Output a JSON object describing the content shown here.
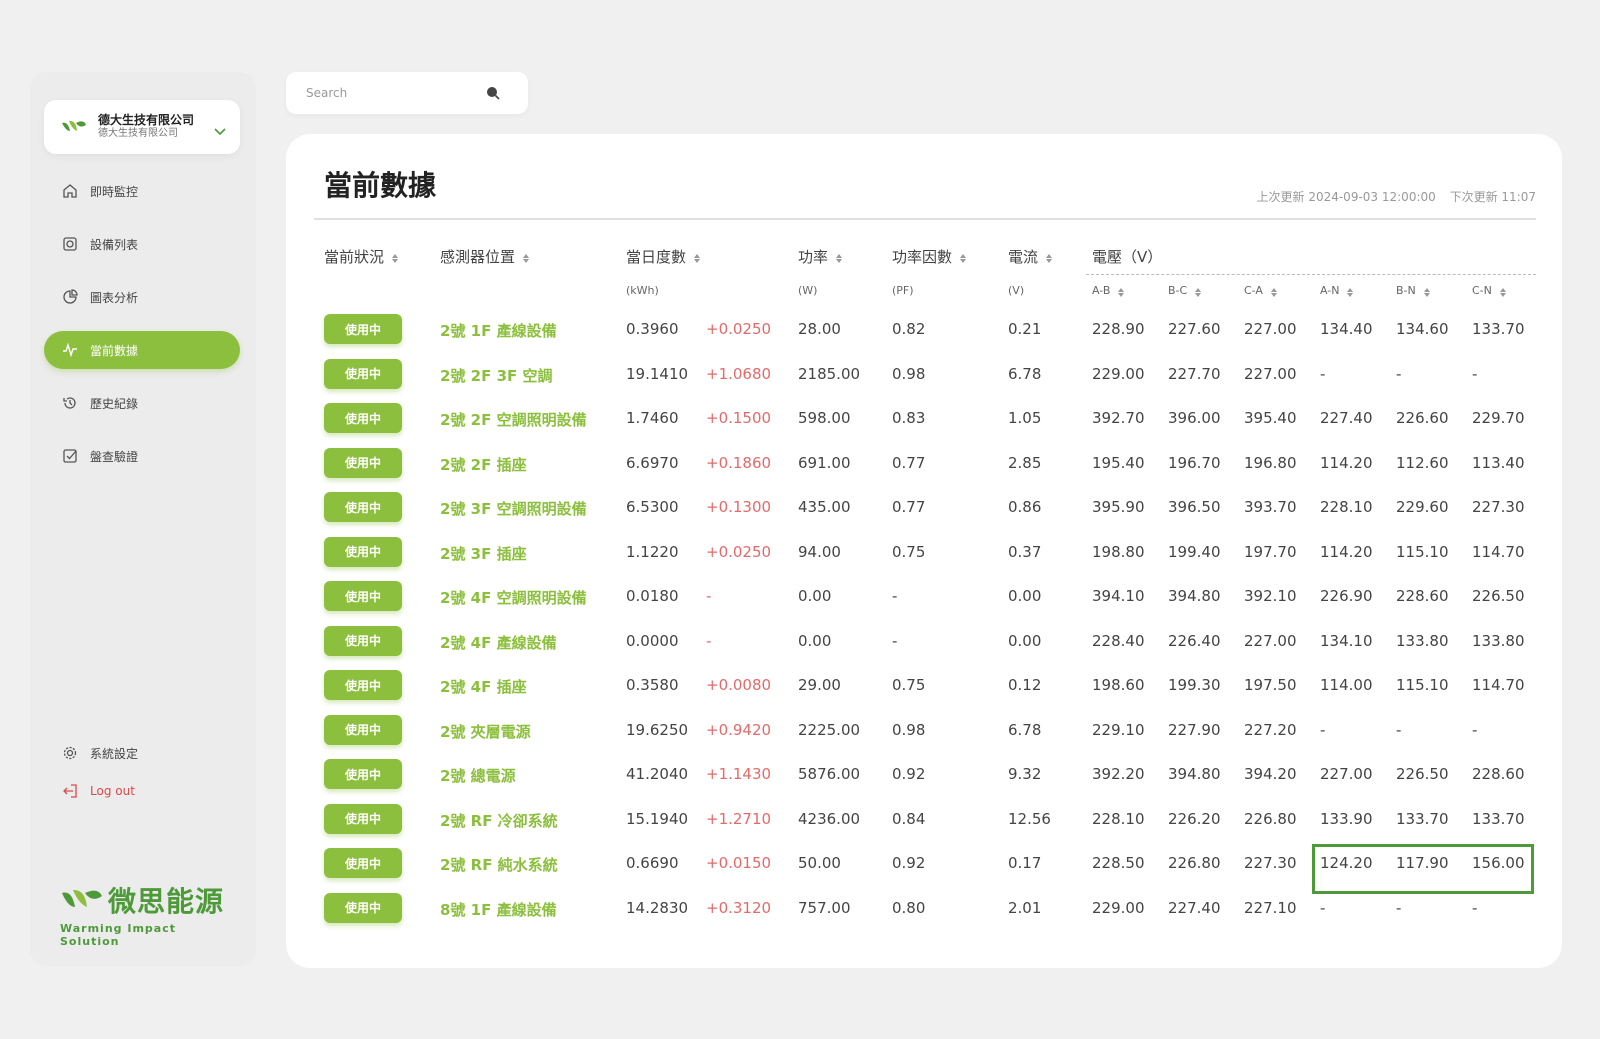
{
  "company": {
    "name": "德大生技有限公司",
    "sub": "德大生技有限公司"
  },
  "nav": [
    {
      "label": "即時監控",
      "icon": "home-icon"
    },
    {
      "label": "設備列表",
      "icon": "device-list-icon"
    },
    {
      "label": "圖表分析",
      "icon": "chart-icon"
    },
    {
      "label": "當前數據",
      "icon": "pulse-icon",
      "active": true
    },
    {
      "label": "歷史紀錄",
      "icon": "history-icon"
    },
    {
      "label": "盤查驗證",
      "icon": "checkbox-icon"
    }
  ],
  "bottom_nav": {
    "settings": "系統設定",
    "logout": "Log out"
  },
  "brand": {
    "name": "微思能源",
    "tagline": "Warming Impact Solution"
  },
  "search": {
    "placeholder": "Search"
  },
  "page": {
    "title": "當前數據",
    "last_update": "上次更新 2024-09-03 12:00:00",
    "next_update": "下次更新 11:07"
  },
  "columns": {
    "status": "當前狀況",
    "location": "感測器位置",
    "daily": "當日度數",
    "power": "功率",
    "pf": "功率因數",
    "current": "電流",
    "voltage": "電壓（V）"
  },
  "units": {
    "daily": "(kWh)",
    "power": "(W)",
    "pf": "(PF)",
    "current": "(V)",
    "ab": "A-B",
    "bc": "B-C",
    "ca": "C-A",
    "an": "A-N",
    "bn": "B-N",
    "cn": "C-N"
  },
  "status_label": "使用中",
  "rows": [
    {
      "loc": "2號 1F 產線設備",
      "kwh": "0.3960",
      "delta": "+0.0250",
      "w": "28.00",
      "pf": "0.82",
      "i": "0.21",
      "ab": "228.90",
      "bc": "227.60",
      "ca": "227.00",
      "an": "134.40",
      "bn": "134.60",
      "cn": "133.70"
    },
    {
      "loc": "2號 2F 3F 空調",
      "kwh": "19.1410",
      "delta": "+1.0680",
      "w": "2185.00",
      "pf": "0.98",
      "i": "6.78",
      "ab": "229.00",
      "bc": "227.70",
      "ca": "227.00",
      "an": "-",
      "bn": "-",
      "cn": "-"
    },
    {
      "loc": "2號 2F 空調照明設備",
      "kwh": "1.7460",
      "delta": "+0.1500",
      "w": "598.00",
      "pf": "0.83",
      "i": "1.05",
      "ab": "392.70",
      "bc": "396.00",
      "ca": "395.40",
      "an": "227.40",
      "bn": "226.60",
      "cn": "229.70"
    },
    {
      "loc": "2號 2F 插座",
      "kwh": "6.6970",
      "delta": "+0.1860",
      "w": "691.00",
      "pf": "0.77",
      "i": "2.85",
      "ab": "195.40",
      "bc": "196.70",
      "ca": "196.80",
      "an": "114.20",
      "bn": "112.60",
      "cn": "113.40"
    },
    {
      "loc": "2號 3F 空調照明設備",
      "kwh": "6.5300",
      "delta": "+0.1300",
      "w": "435.00",
      "pf": "0.77",
      "i": "0.86",
      "ab": "395.90",
      "bc": "396.50",
      "ca": "393.70",
      "an": "228.10",
      "bn": "229.60",
      "cn": "227.30"
    },
    {
      "loc": "2號 3F 插座",
      "kwh": "1.1220",
      "delta": "+0.0250",
      "w": "94.00",
      "pf": "0.75",
      "i": "0.37",
      "ab": "198.80",
      "bc": "199.40",
      "ca": "197.70",
      "an": "114.20",
      "bn": "115.10",
      "cn": "114.70"
    },
    {
      "loc": "2號 4F 空調照明設備",
      "kwh": "0.0180",
      "delta": "-",
      "w": "0.00",
      "pf": "-",
      "i": "0.00",
      "ab": "394.10",
      "bc": "394.80",
      "ca": "392.10",
      "an": "226.90",
      "bn": "228.60",
      "cn": "226.50"
    },
    {
      "loc": "2號 4F 產線設備",
      "kwh": "0.0000",
      "delta": "-",
      "w": "0.00",
      "pf": "-",
      "i": "0.00",
      "ab": "228.40",
      "bc": "226.40",
      "ca": "227.00",
      "an": "134.10",
      "bn": "133.80",
      "cn": "133.80"
    },
    {
      "loc": "2號 4F 插座",
      "kwh": "0.3580",
      "delta": "+0.0080",
      "w": "29.00",
      "pf": "0.75",
      "i": "0.12",
      "ab": "198.60",
      "bc": "199.30",
      "ca": "197.50",
      "an": "114.00",
      "bn": "115.10",
      "cn": "114.70"
    },
    {
      "loc": "2號 夾層電源",
      "kwh": "19.6250",
      "delta": "+0.9420",
      "w": "2225.00",
      "pf": "0.98",
      "i": "6.78",
      "ab": "229.10",
      "bc": "227.90",
      "ca": "227.20",
      "an": "-",
      "bn": "-",
      "cn": "-"
    },
    {
      "loc": "2號 總電源",
      "kwh": "41.2040",
      "delta": "+1.1430",
      "w": "5876.00",
      "pf": "0.92",
      "i": "9.32",
      "ab": "392.20",
      "bc": "394.80",
      "ca": "394.20",
      "an": "227.00",
      "bn": "226.50",
      "cn": "228.60"
    },
    {
      "loc": "2號 RF 冷卻系統",
      "kwh": "15.1940",
      "delta": "+1.2710",
      "w": "4236.00",
      "pf": "0.84",
      "i": "12.56",
      "ab": "228.10",
      "bc": "226.20",
      "ca": "226.80",
      "an": "133.90",
      "bn": "133.70",
      "cn": "133.70"
    },
    {
      "loc": "2號 RF 純水系統",
      "kwh": "0.6690",
      "delta": "+0.0150",
      "w": "50.00",
      "pf": "0.92",
      "i": "0.17",
      "ab": "228.50",
      "bc": "226.80",
      "ca": "227.30",
      "an": "124.20",
      "bn": "117.90",
      "cn": "156.00"
    },
    {
      "loc": "8號 1F 產線設備",
      "kwh": "14.2830",
      "delta": "+0.3120",
      "w": "757.00",
      "pf": "0.80",
      "i": "2.01",
      "ab": "229.00",
      "bc": "227.40",
      "ca": "227.10",
      "an": "-",
      "bn": "-",
      "cn": "-"
    }
  ]
}
